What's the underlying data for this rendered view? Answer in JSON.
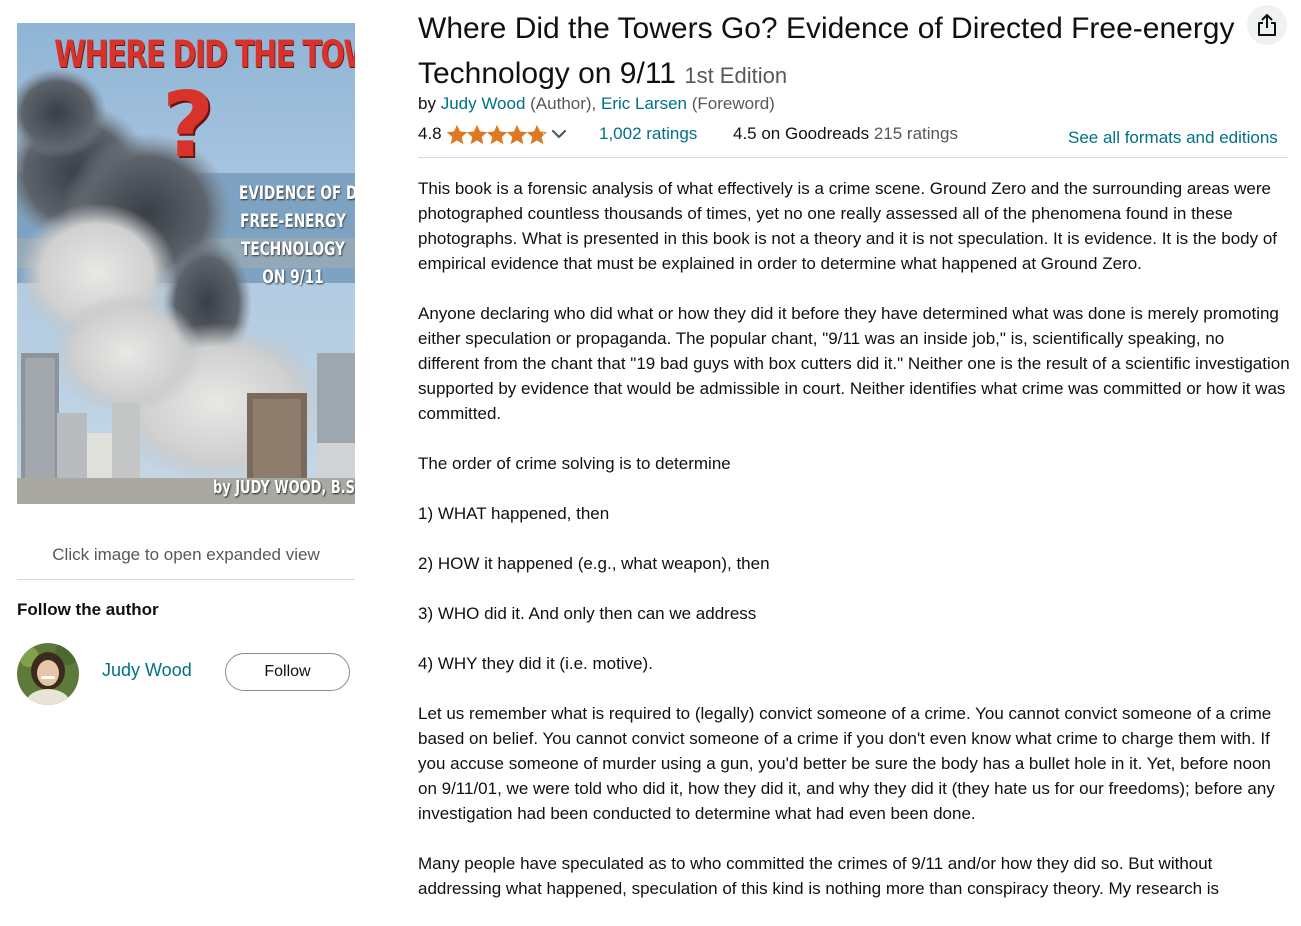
{
  "cover": {
    "title": "WHERE DID THE TOWERS GO",
    "question_mark": "?",
    "subtitle_lines": [
      "EVIDENCE OF DIRECTED",
      "FREE-ENERGY",
      "TECHNOLOGY",
      "ON 9/11"
    ],
    "author": "by JUDY WOOD, B.S., M.S., Ph.D.",
    "expand_hint": "Click image to open expanded view"
  },
  "follow": {
    "heading": "Follow the author",
    "author_name": "Judy Wood",
    "button_label": "Follow"
  },
  "book": {
    "title": "Where Did the Towers Go? Evidence of Directed Free-energy Technology on 9/11",
    "edition": "1st Edition",
    "byline": {
      "prefix": "by ",
      "author": "Judy Wood",
      "author_role": " (Author), ",
      "foreword": "Eric Larsen",
      "foreword_role": " (Foreword)"
    },
    "rating": "4.8",
    "stars_filled": 4.8,
    "ratings_count": "1,002 ratings",
    "goodreads": "4.5 on Goodreads",
    "goodreads_count": "215 ratings",
    "formats_link": "See all formats and editions"
  },
  "description": [
    "This book is a forensic analysis of what effectively is a crime scene. Ground Zero and the surrounding areas were photographed countless thousands of times, yet no one really assessed all of the phenomena found in these photographs. What is presented in this book is not a theory and it is not speculation. It is evidence. It is the body of empirical evidence that must be explained in order to determine what happened at Ground Zero.",
    "Anyone declaring who did what or how they did it before they have determined what was done is merely promoting either speculation or propaganda. The popular chant, \"9/11 was an inside job,\" is, scientifically speaking, no different from the chant that \"19 bad guys with box cutters did it.\" Neither one is the result of a scientific investigation supported by evidence that would be admissible in court. Neither identifies what crime was committed or how it was committed.",
    "The order of crime solving is to determine",
    "1) WHAT happened, then",
    "2) HOW it happened (e.g., what weapon), then",
    "3) WHO did it. And only then can we address",
    "4) WHY they did it (i.e. motive).",
    "Let us remember what is required to (legally) convict someone of a crime. You cannot convict someone of a crime based on belief. You cannot convict someone of a crime if you don't even know what crime to charge them with. If you accuse someone of murder using a gun, you'd better be sure the body has a bullet hole in it. Yet, before noon on 9/11/01, we were told who did it, how they did it, and why they did it (they hate us for our freedoms); before any investigation had been conducted to determine what had even been done.",
    "Many people have speculated as to who committed the crimes of 9/11 and/or how they did so. But without addressing what happened, speculation of this kind is nothing more than conspiracy theory. My research is"
  ],
  "colors": {
    "link": "#007185",
    "star": "#de7921",
    "text": "#0f1111",
    "muted": "#565959",
    "cover_title": "#d8332a"
  },
  "icons": {
    "share": "share-icon",
    "star": "star-icon",
    "chevron": "chevron-down-icon"
  }
}
